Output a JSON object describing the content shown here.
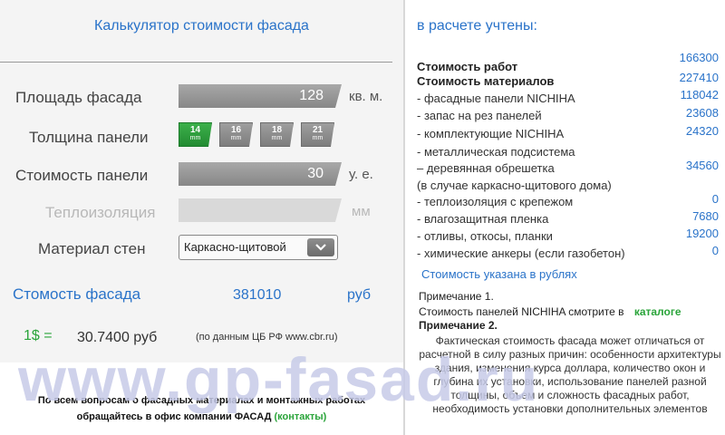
{
  "calculator": {
    "title": "Калькулятор стоимости фасада",
    "facade_area": {
      "label": "Площадь фасада",
      "value": "128",
      "unit": "кв. м."
    },
    "panel_thickness": {
      "label": "Толщина панели",
      "unit": "mm",
      "options": [
        "14",
        "16",
        "18",
        "21"
      ],
      "selected": "14"
    },
    "panel_cost": {
      "label": "Стоимость панели",
      "value": "30",
      "unit": "у. е."
    },
    "insulation": {
      "label": "Теплоизоляция",
      "value": "",
      "unit": "мм"
    },
    "wall_material": {
      "label": "Материал стен",
      "selected": "Каркасно-щитовой"
    },
    "total": {
      "label": "Стомость фасада",
      "value": "381010",
      "unit": "руб"
    },
    "rate": {
      "label": "1$ =",
      "value": "30.7400 руб",
      "source": "(по данным ЦБ РФ www.cbr.ru)"
    },
    "contact": {
      "line1": "По всем вопросам о фасадных материалах и монтажных работах",
      "line2": "обращайтесь в офис компании ФАСАД",
      "link": "(контакты)"
    },
    "watermark": "www.gp-fasad.ru"
  },
  "breakdown": {
    "title": "в расчете учтены:",
    "work": {
      "label": "Стоимость работ",
      "value": "166300"
    },
    "materials": {
      "label": "Стоимость материалов",
      "value": "227410"
    },
    "items": [
      {
        "label": "- фасадные панели NICHIHA",
        "value": "118042"
      },
      {
        "label": "- запас на рез панелей",
        "value": "23608"
      },
      {
        "label": "- комплектующие NICHIHA",
        "value": "24320"
      },
      {
        "label": "- металлическая подсистема",
        "value": ""
      },
      {
        "label": "– деревянная обрешетка",
        "value": "34560"
      },
      {
        "label": "(в случае каркасно-щитового дома)",
        "value": ""
      },
      {
        "label": "- теплоизоляция с крепежом",
        "value": "0"
      },
      {
        "label": "- влагозащитная пленка",
        "value": "7680"
      },
      {
        "label": "- отливы, откосы, планки",
        "value": "19200"
      },
      {
        "label": "- химические анкеры (если газобетон)",
        "value": "0"
      }
    ],
    "currency_note": "Стоимость указана в рублях",
    "note1_title": "Примечание 1.",
    "note1_text": "Стоимость панелей NICHIHA смотрите в",
    "note1_link": "каталоге",
    "note2_title": "Примечание 2.",
    "note2_text": "Фактическая стоимость фасада может отличаться от расчетной в силу разных причин: особенности архитектуры здания, изменения курса доллара, количество окон и глубина их установки, использование панелей разной толщины, объем и сложность фасадных работ, необходимость установки дополнительных элементов"
  }
}
